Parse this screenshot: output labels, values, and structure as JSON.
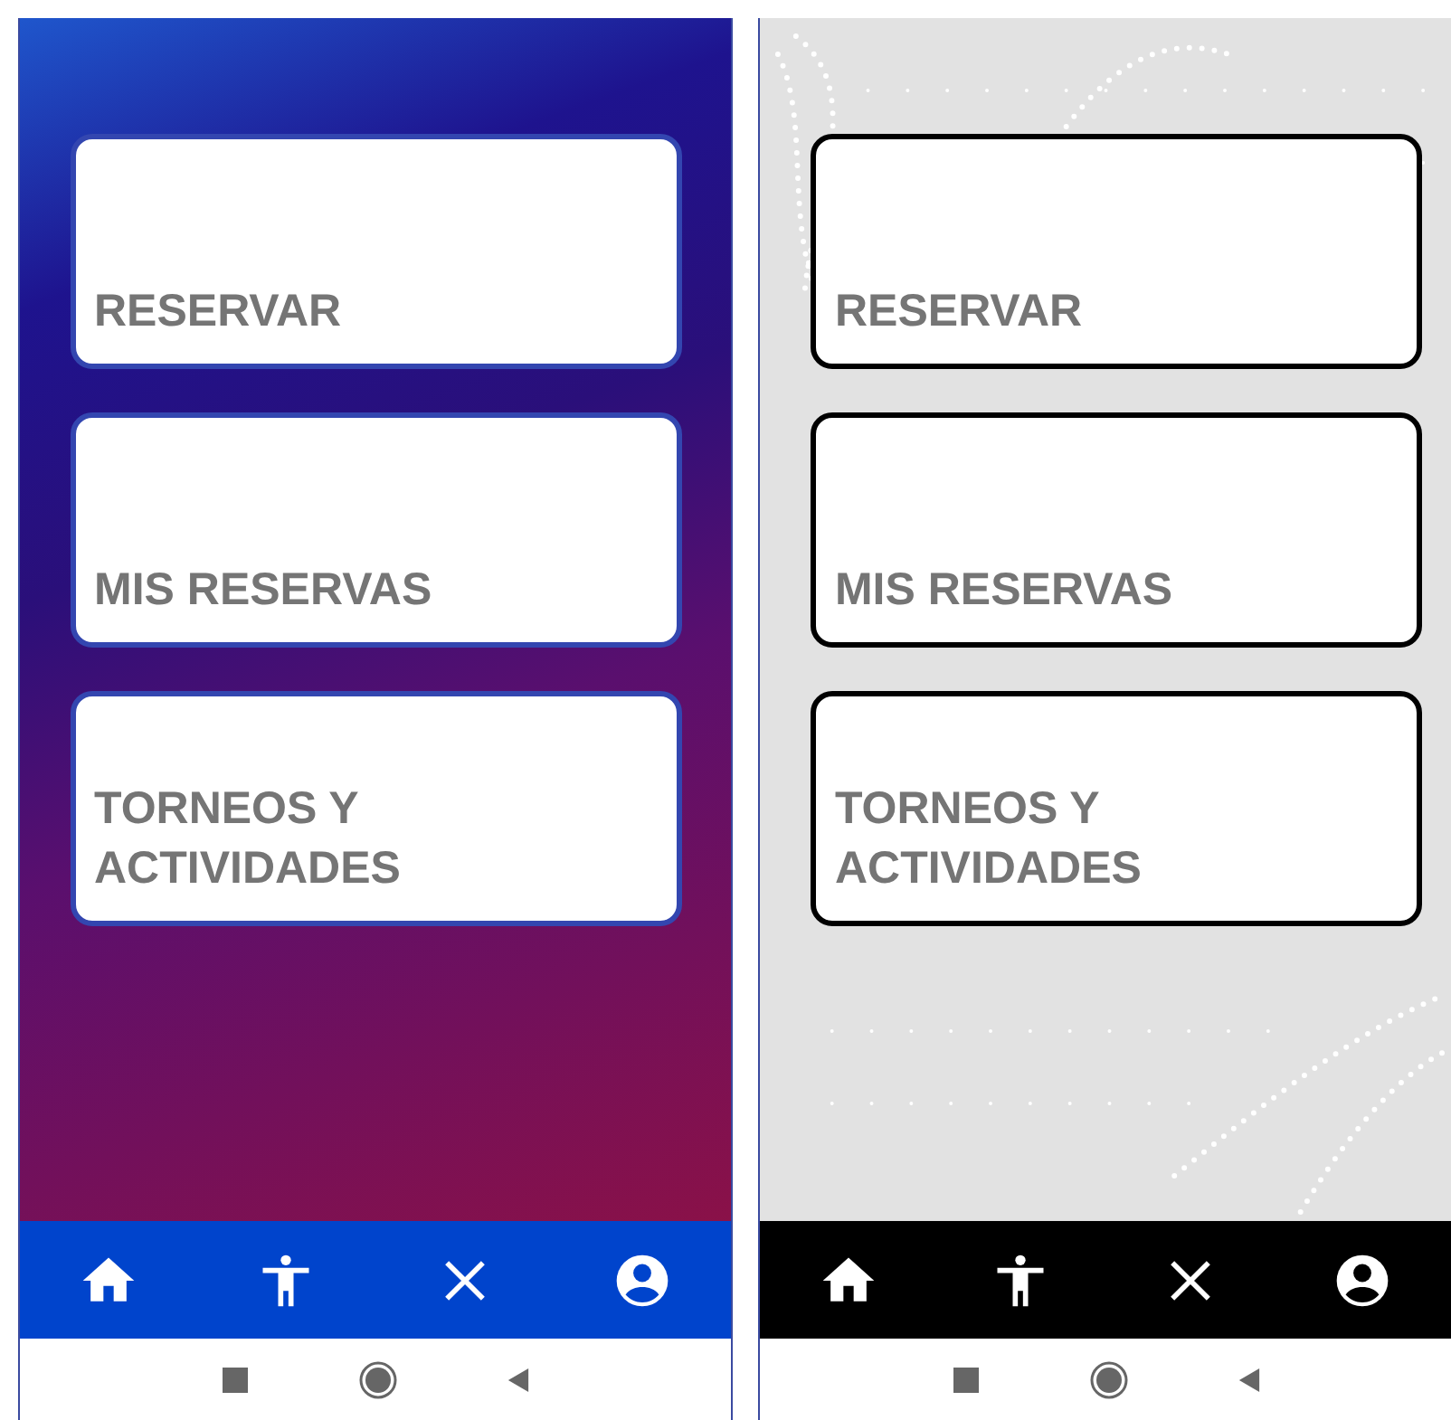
{
  "screens": [
    {
      "kind": "gradient",
      "cards": [
        {
          "label": "RESERVAR"
        },
        {
          "label": "MIS RESERVAS"
        },
        {
          "label": "TORNEOS Y ACTIVIDADES"
        }
      ]
    },
    {
      "kind": "light",
      "cards": [
        {
          "label": "RESERVAR"
        },
        {
          "label": "MIS RESERVAS"
        },
        {
          "label": "TORNEOS Y ACTIVIDADES"
        }
      ]
    }
  ]
}
